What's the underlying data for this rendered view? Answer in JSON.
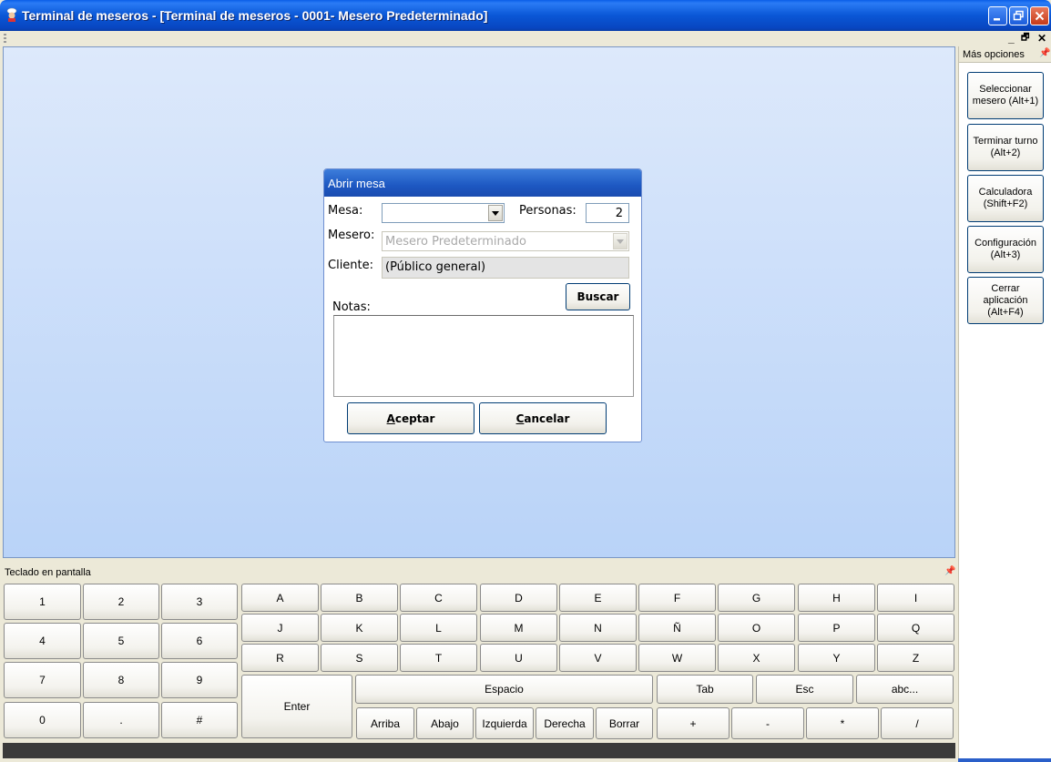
{
  "window": {
    "title": "Terminal de meseros - [Terminal de meseros - 0001- Mesero Predeterminado]"
  },
  "mdi": {
    "minimize": "_",
    "restore": "🗗",
    "close": "✕"
  },
  "dialog": {
    "title": "Abrir mesa",
    "mesa_label": "Mesa:",
    "mesa_value": "",
    "personas_label": "Personas:",
    "personas_value": "2",
    "mesero_label": "Mesero:",
    "mesero_value": "Mesero Predeterminado",
    "cliente_label": "Cliente:",
    "cliente_value": "(Público general)",
    "buscar": "Buscar",
    "notas_label": "Notas:",
    "aceptar_first": "A",
    "aceptar_rest": "ceptar",
    "cancelar_first": "C",
    "cancelar_rest": "ancelar"
  },
  "side_panel": {
    "title": "Más opciones",
    "pin": "📌",
    "buttons": [
      "Seleccionar mesero (Alt+1)",
      "Terminar turno (Alt+2)",
      "Calculadora (Shift+F2)",
      "Configuración (Alt+3)",
      "Cerrar aplicación (Alt+F4)"
    ]
  },
  "keyboard": {
    "title": "Teclado en pantalla",
    "pin": "📌",
    "num_row1": [
      "1",
      "2",
      "3"
    ],
    "num_row2": [
      "4",
      "5",
      "6"
    ],
    "num_row3": [
      "7",
      "8",
      "9"
    ],
    "num_row4": [
      "0",
      ".",
      "#"
    ],
    "row1": [
      "A",
      "B",
      "C",
      "D",
      "E",
      "F",
      "G",
      "H",
      "I"
    ],
    "row2": [
      "J",
      "K",
      "L",
      "M",
      "N",
      "Ñ",
      "O",
      "P",
      "Q"
    ],
    "row3": [
      "R",
      "S",
      "T",
      "U",
      "V",
      "W",
      "X",
      "Y",
      "Z"
    ],
    "enter": "Enter",
    "espacio": "Espacio",
    "tab": "Tab",
    "esc": "Esc",
    "abc": "abc...",
    "arrows": [
      "Arriba",
      "Abajo",
      "Izquierda",
      "Derecha",
      "Borrar"
    ],
    "ops": [
      "+",
      "-",
      "*",
      "/"
    ]
  }
}
